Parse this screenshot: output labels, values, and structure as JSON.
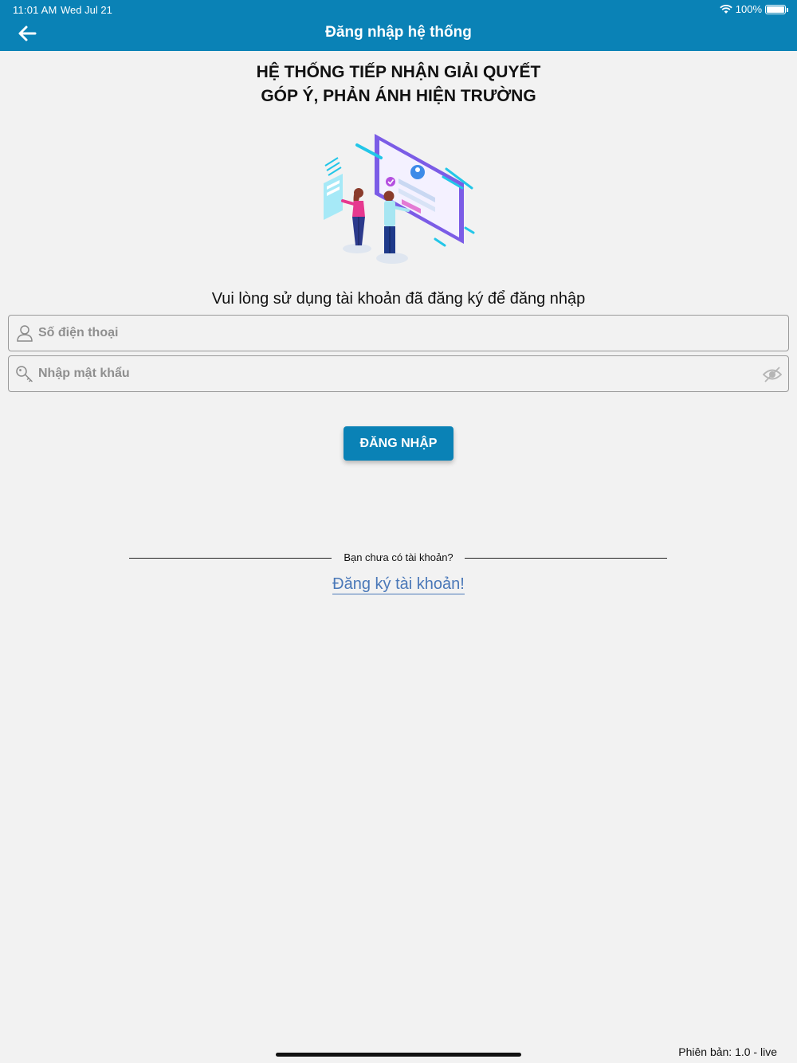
{
  "status_bar": {
    "time": "11:01 AM",
    "date": "Wed Jul 21",
    "battery": "100%"
  },
  "nav": {
    "title": "Đăng nhập hệ thống",
    "back_icon": "arrow-left-icon"
  },
  "heading": {
    "line1": "HỆ THỐNG TIẾP NHẬN GIẢI QUYẾT",
    "line2": "GÓP Ý, PHẢN ÁNH HIỆN TRƯỜNG"
  },
  "instruction": "Vui lòng sử dụng tài khoản đã đăng ký để đăng nhập",
  "form": {
    "phone_placeholder": "Số điện thoại",
    "password_placeholder": "Nhập mật khẩu",
    "phone_icon": "user-icon",
    "password_icon": "key-icon",
    "visibility_icon": "eye-slash-icon",
    "login_label": "ĐĂNG NHẬP"
  },
  "register": {
    "prompt": "Bạn chưa có tài khoản?",
    "link_label": "Đăng ký tài khoản!"
  },
  "footer": {
    "version": "Phiên bản: 1.0 - live"
  },
  "colors": {
    "primary": "#0a82b6",
    "link": "#4a78b8",
    "background": "#f2f2f2"
  }
}
